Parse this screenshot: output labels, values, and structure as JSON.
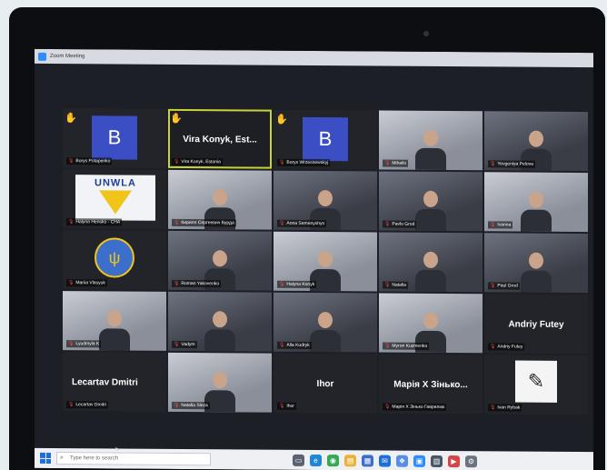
{
  "app": {
    "window_title": "Zoom Meeting"
  },
  "tiles": [
    {
      "type": "avatar",
      "initial": "B",
      "name": "Borys Potapenko",
      "hand": true
    },
    {
      "type": "speaker",
      "display_name": "Vira Konyk, Est...",
      "name": "Vira Konyk, Estonia",
      "hand": true
    },
    {
      "type": "avatar",
      "initial": "B",
      "name": "Borys Wrzesnewskyj",
      "hand": true
    },
    {
      "type": "video",
      "name": "Mihailo"
    },
    {
      "type": "video",
      "name": "Yevgeniya Pelova"
    },
    {
      "type": "logo-unwla",
      "logo_text": "UNWLA",
      "name": "Halyna Hensko - CHA"
    },
    {
      "type": "video",
      "name": "Кирилл Сергеевич Бурда"
    },
    {
      "type": "video",
      "name": "Anna Semenyshyn"
    },
    {
      "type": "video",
      "name": "Pavlo Grod"
    },
    {
      "type": "video",
      "name": "Ivanna"
    },
    {
      "type": "trident",
      "name": "Mariia Vlasyuk"
    },
    {
      "type": "video",
      "name": "Roman Yakovenko"
    },
    {
      "type": "video",
      "name": "Halyna Konyk"
    },
    {
      "type": "video",
      "name": "Natalia"
    },
    {
      "type": "video",
      "name": "Paul Grod"
    },
    {
      "type": "video",
      "name": "Lyudmyla K"
    },
    {
      "type": "video",
      "name": "Vadym"
    },
    {
      "type": "video",
      "name": "Alla Kudryk"
    },
    {
      "type": "video",
      "name": "Myron Kuzmenko"
    },
    {
      "type": "name-only",
      "display_name": "Andriy Futey",
      "name": "Andriy Futey"
    },
    {
      "type": "name-only",
      "display_name": "Lecartav Dmitri",
      "name": "Lecartav Dmitri",
      "align": "left"
    },
    {
      "type": "video",
      "name": "Natalia Sleza"
    },
    {
      "type": "name-only",
      "display_name": "Ihor",
      "name": "Ihor"
    },
    {
      "type": "name-only",
      "display_name": "Марія Х Зінько...",
      "name": "Марія Х Зінько Гаврилюк"
    },
    {
      "type": "drawing",
      "name": "Ivan Rybak"
    }
  ],
  "taskbar": {
    "search_placeholder": "Type here to search",
    "icons": [
      {
        "name": "task-view-icon",
        "glyph": "▭",
        "color": "#5b6270"
      },
      {
        "name": "edge-icon",
        "glyph": "e",
        "color": "#1e88d6"
      },
      {
        "name": "chrome-icon",
        "glyph": "◉",
        "color": "#34a853"
      },
      {
        "name": "explorer-icon",
        "glyph": "▤",
        "color": "#e9b23b"
      },
      {
        "name": "store-icon",
        "glyph": "▦",
        "color": "#3b6fcb"
      },
      {
        "name": "mail-icon",
        "glyph": "✉",
        "color": "#1e6fd6"
      },
      {
        "name": "photos-icon",
        "glyph": "❖",
        "color": "#5a8ee6"
      },
      {
        "name": "zoom-icon",
        "glyph": "▣",
        "color": "#2d8cff"
      },
      {
        "name": "calendar-icon",
        "glyph": "▥",
        "color": "#4a5568"
      },
      {
        "name": "media-icon",
        "glyph": "▶",
        "color": "#d64545"
      },
      {
        "name": "settings-icon",
        "glyph": "⚙",
        "color": "#6b7280"
      }
    ]
  }
}
